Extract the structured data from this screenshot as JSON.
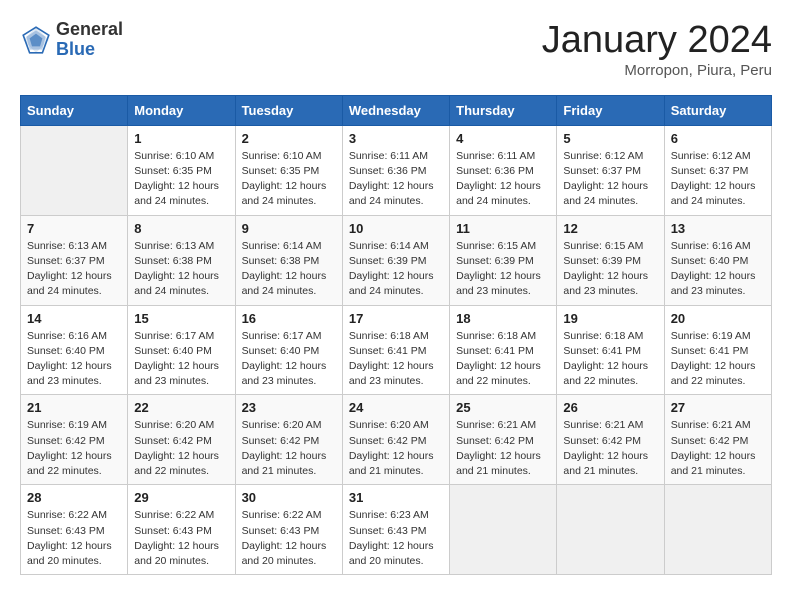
{
  "header": {
    "logo_general": "General",
    "logo_blue": "Blue",
    "month_title": "January 2024",
    "subtitle": "Morropon, Piura, Peru"
  },
  "days_of_week": [
    "Sunday",
    "Monday",
    "Tuesday",
    "Wednesday",
    "Thursday",
    "Friday",
    "Saturday"
  ],
  "weeks": [
    [
      {
        "day": "",
        "sunrise": "",
        "sunset": "",
        "daylight": ""
      },
      {
        "day": "1",
        "sunrise": "Sunrise: 6:10 AM",
        "sunset": "Sunset: 6:35 PM",
        "daylight": "Daylight: 12 hours and 24 minutes."
      },
      {
        "day": "2",
        "sunrise": "Sunrise: 6:10 AM",
        "sunset": "Sunset: 6:35 PM",
        "daylight": "Daylight: 12 hours and 24 minutes."
      },
      {
        "day": "3",
        "sunrise": "Sunrise: 6:11 AM",
        "sunset": "Sunset: 6:36 PM",
        "daylight": "Daylight: 12 hours and 24 minutes."
      },
      {
        "day": "4",
        "sunrise": "Sunrise: 6:11 AM",
        "sunset": "Sunset: 6:36 PM",
        "daylight": "Daylight: 12 hours and 24 minutes."
      },
      {
        "day": "5",
        "sunrise": "Sunrise: 6:12 AM",
        "sunset": "Sunset: 6:37 PM",
        "daylight": "Daylight: 12 hours and 24 minutes."
      },
      {
        "day": "6",
        "sunrise": "Sunrise: 6:12 AM",
        "sunset": "Sunset: 6:37 PM",
        "daylight": "Daylight: 12 hours and 24 minutes."
      }
    ],
    [
      {
        "day": "7",
        "sunrise": "Sunrise: 6:13 AM",
        "sunset": "Sunset: 6:37 PM",
        "daylight": "Daylight: 12 hours and 24 minutes."
      },
      {
        "day": "8",
        "sunrise": "Sunrise: 6:13 AM",
        "sunset": "Sunset: 6:38 PM",
        "daylight": "Daylight: 12 hours and 24 minutes."
      },
      {
        "day": "9",
        "sunrise": "Sunrise: 6:14 AM",
        "sunset": "Sunset: 6:38 PM",
        "daylight": "Daylight: 12 hours and 24 minutes."
      },
      {
        "day": "10",
        "sunrise": "Sunrise: 6:14 AM",
        "sunset": "Sunset: 6:39 PM",
        "daylight": "Daylight: 12 hours and 24 minutes."
      },
      {
        "day": "11",
        "sunrise": "Sunrise: 6:15 AM",
        "sunset": "Sunset: 6:39 PM",
        "daylight": "Daylight: 12 hours and 23 minutes."
      },
      {
        "day": "12",
        "sunrise": "Sunrise: 6:15 AM",
        "sunset": "Sunset: 6:39 PM",
        "daylight": "Daylight: 12 hours and 23 minutes."
      },
      {
        "day": "13",
        "sunrise": "Sunrise: 6:16 AM",
        "sunset": "Sunset: 6:40 PM",
        "daylight": "Daylight: 12 hours and 23 minutes."
      }
    ],
    [
      {
        "day": "14",
        "sunrise": "Sunrise: 6:16 AM",
        "sunset": "Sunset: 6:40 PM",
        "daylight": "Daylight: 12 hours and 23 minutes."
      },
      {
        "day": "15",
        "sunrise": "Sunrise: 6:17 AM",
        "sunset": "Sunset: 6:40 PM",
        "daylight": "Daylight: 12 hours and 23 minutes."
      },
      {
        "day": "16",
        "sunrise": "Sunrise: 6:17 AM",
        "sunset": "Sunset: 6:40 PM",
        "daylight": "Daylight: 12 hours and 23 minutes."
      },
      {
        "day": "17",
        "sunrise": "Sunrise: 6:18 AM",
        "sunset": "Sunset: 6:41 PM",
        "daylight": "Daylight: 12 hours and 23 minutes."
      },
      {
        "day": "18",
        "sunrise": "Sunrise: 6:18 AM",
        "sunset": "Sunset: 6:41 PM",
        "daylight": "Daylight: 12 hours and 22 minutes."
      },
      {
        "day": "19",
        "sunrise": "Sunrise: 6:18 AM",
        "sunset": "Sunset: 6:41 PM",
        "daylight": "Daylight: 12 hours and 22 minutes."
      },
      {
        "day": "20",
        "sunrise": "Sunrise: 6:19 AM",
        "sunset": "Sunset: 6:41 PM",
        "daylight": "Daylight: 12 hours and 22 minutes."
      }
    ],
    [
      {
        "day": "21",
        "sunrise": "Sunrise: 6:19 AM",
        "sunset": "Sunset: 6:42 PM",
        "daylight": "Daylight: 12 hours and 22 minutes."
      },
      {
        "day": "22",
        "sunrise": "Sunrise: 6:20 AM",
        "sunset": "Sunset: 6:42 PM",
        "daylight": "Daylight: 12 hours and 22 minutes."
      },
      {
        "day": "23",
        "sunrise": "Sunrise: 6:20 AM",
        "sunset": "Sunset: 6:42 PM",
        "daylight": "Daylight: 12 hours and 21 minutes."
      },
      {
        "day": "24",
        "sunrise": "Sunrise: 6:20 AM",
        "sunset": "Sunset: 6:42 PM",
        "daylight": "Daylight: 12 hours and 21 minutes."
      },
      {
        "day": "25",
        "sunrise": "Sunrise: 6:21 AM",
        "sunset": "Sunset: 6:42 PM",
        "daylight": "Daylight: 12 hours and 21 minutes."
      },
      {
        "day": "26",
        "sunrise": "Sunrise: 6:21 AM",
        "sunset": "Sunset: 6:42 PM",
        "daylight": "Daylight: 12 hours and 21 minutes."
      },
      {
        "day": "27",
        "sunrise": "Sunrise: 6:21 AM",
        "sunset": "Sunset: 6:42 PM",
        "daylight": "Daylight: 12 hours and 21 minutes."
      }
    ],
    [
      {
        "day": "28",
        "sunrise": "Sunrise: 6:22 AM",
        "sunset": "Sunset: 6:43 PM",
        "daylight": "Daylight: 12 hours and 20 minutes."
      },
      {
        "day": "29",
        "sunrise": "Sunrise: 6:22 AM",
        "sunset": "Sunset: 6:43 PM",
        "daylight": "Daylight: 12 hours and 20 minutes."
      },
      {
        "day": "30",
        "sunrise": "Sunrise: 6:22 AM",
        "sunset": "Sunset: 6:43 PM",
        "daylight": "Daylight: 12 hours and 20 minutes."
      },
      {
        "day": "31",
        "sunrise": "Sunrise: 6:23 AM",
        "sunset": "Sunset: 6:43 PM",
        "daylight": "Daylight: 12 hours and 20 minutes."
      },
      {
        "day": "",
        "sunrise": "",
        "sunset": "",
        "daylight": ""
      },
      {
        "day": "",
        "sunrise": "",
        "sunset": "",
        "daylight": ""
      },
      {
        "day": "",
        "sunrise": "",
        "sunset": "",
        "daylight": ""
      }
    ]
  ]
}
